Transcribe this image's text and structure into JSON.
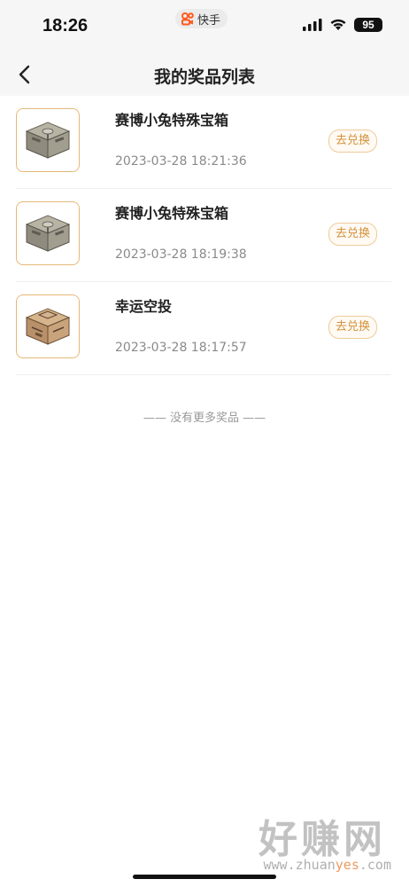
{
  "status_bar": {
    "time": "18:26",
    "app_name": "快手",
    "battery": "95",
    "icons": [
      "signal-icon",
      "wifi-icon",
      "battery-icon"
    ]
  },
  "header": {
    "title": "我的奖品列表",
    "back_icon": "chevron-left-icon"
  },
  "prizes": [
    {
      "name": "赛博小兔特殊宝箱",
      "time": "2023-03-28 18:21:36",
      "action": "去兑换",
      "image": "cyber-box"
    },
    {
      "name": "赛博小兔特殊宝箱",
      "time": "2023-03-28 18:19:38",
      "action": "去兑换",
      "image": "cyber-box"
    },
    {
      "name": "幸运空投",
      "time": "2023-03-28 18:17:57",
      "action": "去兑换",
      "image": "airdrop-box"
    }
  ],
  "end_note": "—— 没有更多奖品 ——",
  "watermark": {
    "main": "好赚网",
    "domain_pre": "www.zhuan",
    "domain_accent": "yes",
    "domain_post": ".com"
  },
  "colors": {
    "accent": "#d4913c",
    "border": "#e6b978",
    "background": "#f6f6f6"
  }
}
